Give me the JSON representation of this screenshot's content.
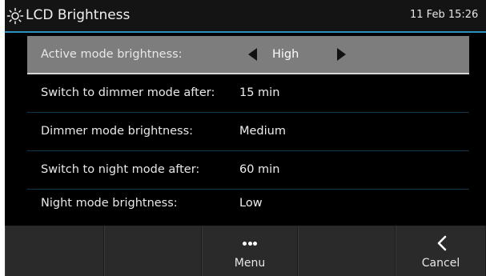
{
  "header": {
    "icon": "sun-icon",
    "title": "LCD Brightness",
    "clock": "11 Feb 15:26"
  },
  "settings": [
    {
      "label": "Active mode brightness:",
      "value": "High",
      "selected": true
    },
    {
      "label": "Switch to dimmer mode after:",
      "value": "15 min",
      "selected": false
    },
    {
      "label": "Dimmer mode brightness:",
      "value": "Medium",
      "selected": false
    },
    {
      "label": "Switch to night mode after:",
      "value": "60 min",
      "selected": false
    },
    {
      "label": "Night mode brightness:",
      "value": "Low",
      "selected": false
    }
  ],
  "softkeys": [
    {
      "label": "",
      "icon": ""
    },
    {
      "label": "",
      "icon": ""
    },
    {
      "label": "Menu",
      "icon": "more-dots-icon"
    },
    {
      "label": "",
      "icon": ""
    },
    {
      "label": "Cancel",
      "icon": "chevron-left-icon"
    }
  ],
  "colors": {
    "accent": "#2f8fbf",
    "selected_row": "#7d7d7d",
    "background": "#000000",
    "softkey_bar": "#2a2a2a"
  }
}
